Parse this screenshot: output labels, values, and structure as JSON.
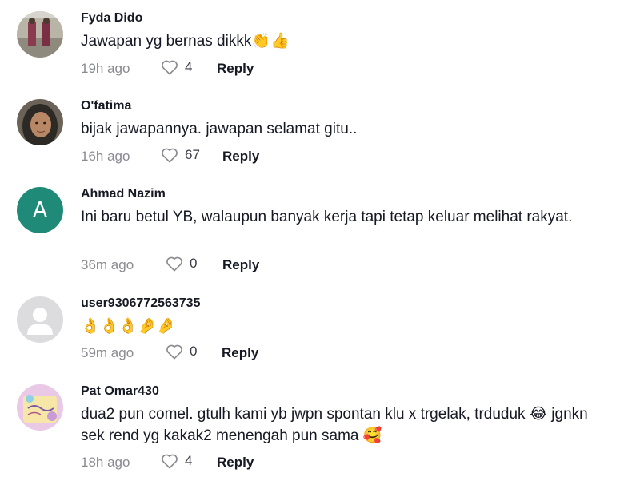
{
  "comments": [
    {
      "username": "Fyda Dido",
      "text": "Jawapan yg bernas dikkk👏👍",
      "time": "19h ago",
      "likes": "4",
      "reply_label": "Reply"
    },
    {
      "username": "O'fatima",
      "text": "bijak jawapannya. jawapan selamat gitu..",
      "time": "16h ago",
      "likes": "67",
      "reply_label": "Reply"
    },
    {
      "username": "Ahmad Nazim",
      "avatar_letter": "A",
      "text": "Ini baru betul YB, walaupun banyak kerja tapi tetap keluar melihat rakyat.",
      "time": "36m ago",
      "likes": "0",
      "reply_label": "Reply"
    },
    {
      "username": "user9306772563735",
      "text": "👌👌👌🤌🤌",
      "time": "59m ago",
      "likes": "0",
      "reply_label": "Reply"
    },
    {
      "username": "Pat Omar430",
      "text": "dua2 pun comel. gtulh kami yb jwpn spontan klu x trgelak, trduduk 😂 jgnkn sek rend yg kakak2 menengah pun sama 🥰",
      "time": "18h ago",
      "likes": "4",
      "reply_label": "Reply"
    }
  ],
  "colors": {
    "username": "#161823",
    "meta": "#8a8b91",
    "letter_avatar_bg": "#1f8a78"
  },
  "icons": {
    "like": "heart-outline-icon",
    "default_avatar": "person-silhouette-icon"
  }
}
